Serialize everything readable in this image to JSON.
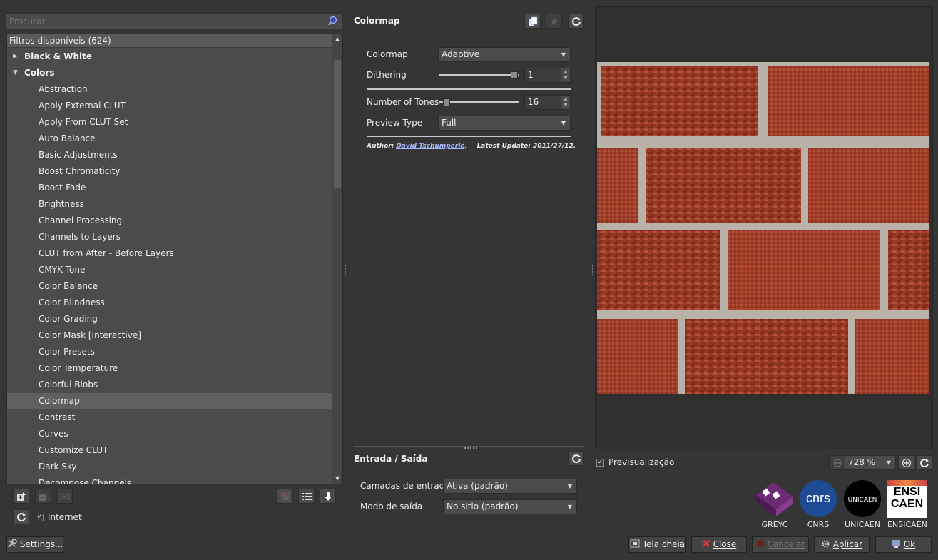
{
  "left": {
    "search_placeholder": "Procurar",
    "tree_header": "Filtros disponíveis (624)",
    "categories": [
      {
        "label": "Black & White",
        "expanded": false
      },
      {
        "label": "Colors",
        "expanded": true
      }
    ],
    "items": [
      "Abstraction",
      "Apply External CLUT",
      "Apply From CLUT Set",
      "Auto Balance",
      "Basic Adjustments",
      "Boost Chromaticity",
      "Boost-Fade",
      "Brightness",
      "Channel Processing",
      "Channels to Layers",
      "CLUT from After - Before Layers",
      "CMYK Tone",
      "Color Balance",
      "Color Blindness",
      "Color Grading",
      "Color Mask [Interactive]",
      "Color Presets",
      "Color Temperature",
      "Colorful Blobs",
      "Colormap",
      "Contrast",
      "Curves",
      "Customize CLUT",
      "Dark Sky",
      "Decompose Channels"
    ],
    "selected_item": "Colormap",
    "internet_label": "Internet",
    "internet_checked": true,
    "settings_label": "Settings..."
  },
  "filter": {
    "title": "Colormap",
    "params": {
      "colormap_label": "Colormap",
      "colormap_value": "Adaptive",
      "dithering_label": "Dithering",
      "dithering_value": "1",
      "tones_label": "Number of Tones",
      "tones_value": "16",
      "preview_type_label": "Preview Type",
      "preview_type_value": "Full"
    },
    "author_prefix": "Author:",
    "author_name": "David Tschumperlé",
    "latest_update": "Latest Update: 2011/27/12."
  },
  "io": {
    "title": "Entrada / Saída",
    "input_label": "Camadas de entrada",
    "input_value": "Ativa (padrão)",
    "output_label": "Modo de saída",
    "output_value": "No sitio (padrão)"
  },
  "preview": {
    "preview_label": "Previsualização",
    "preview_checked": true,
    "zoom": "728 %"
  },
  "logos": {
    "greyc": "GREYC",
    "cnrs": "CNRS",
    "cnrs_mark": "cnrs",
    "unicaen": "UNICAEN",
    "ensicaen": "ENSICAEN",
    "ensicaen_mark_1": "ENSI",
    "ensicaen_mark_2": "CAEN"
  },
  "bottom_buttons": {
    "fullscreen": "Tela cheia",
    "close": "Close",
    "cancel": "Cancelar",
    "apply": "Aplicar",
    "ok": "Ok"
  },
  "colors": {
    "background": "#353535",
    "list_background": "#4b4b4b",
    "selection": "#5f5f5f",
    "brick": "#9c3a26",
    "mortar": "#b8b2a8"
  }
}
